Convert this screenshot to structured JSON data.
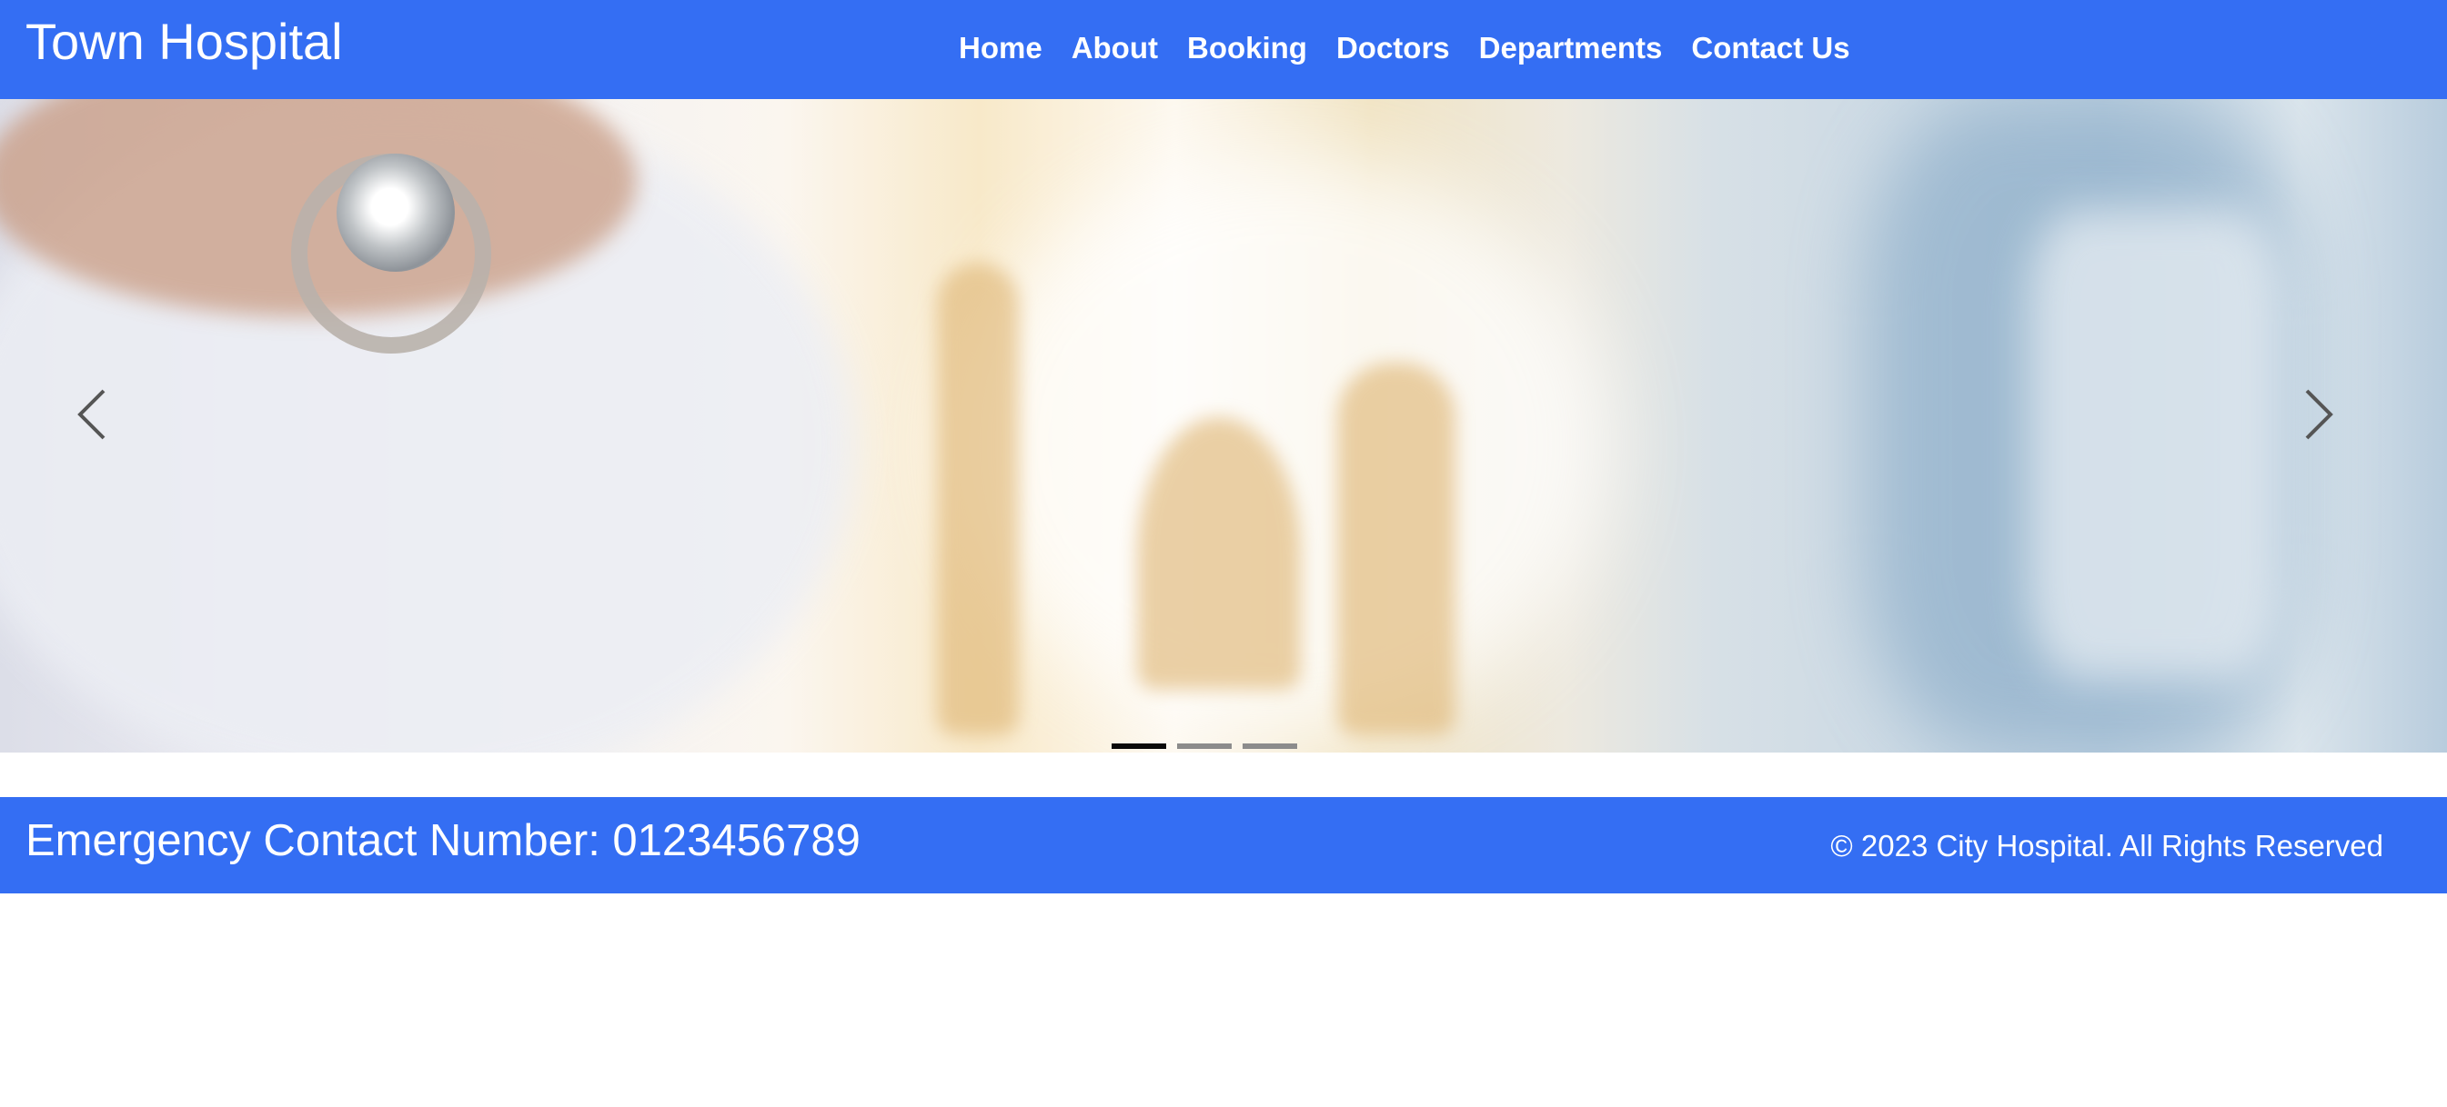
{
  "header": {
    "brand": "Town Hospital",
    "nav": [
      "Home",
      "About",
      "Booking",
      "Doctors",
      "Departments",
      "Contact Us"
    ]
  },
  "carousel": {
    "slide_count": 3,
    "active_slide": 1,
    "prev_icon": "chevron-left-icon",
    "next_icon": "chevron-right-icon"
  },
  "footer": {
    "emergency": "Emergency Contact Number: 0123456789",
    "copyright": "© 2023 City Hospital. All Rights Reserved"
  },
  "colors": {
    "brand_blue": "#346ef3",
    "text_on_brand": "#ffffff",
    "indicator_active": "#0a0a0a",
    "indicator_inactive": "#8c8c8c"
  }
}
